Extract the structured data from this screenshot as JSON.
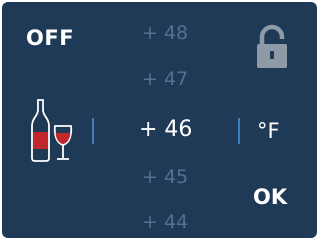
{
  "controls": {
    "off_label": "OFF",
    "ok_label": "OK",
    "unit_label": "°F"
  },
  "temperature_picker": {
    "values": [
      "+ 48",
      "+ 47",
      "+ 46",
      "+ 45",
      "+ 44"
    ],
    "selected_index": 2
  },
  "icons": {
    "lock": "lock-icon",
    "wine": "wine-bottle-and-glass-icon"
  },
  "colors": {
    "background": "#1f3a56",
    "text": "#ffffff",
    "faded_text": "#52718e",
    "separator": "#3f7fc0",
    "wine_red": "#c1272d",
    "lock_grey": "#8e9ba7"
  }
}
